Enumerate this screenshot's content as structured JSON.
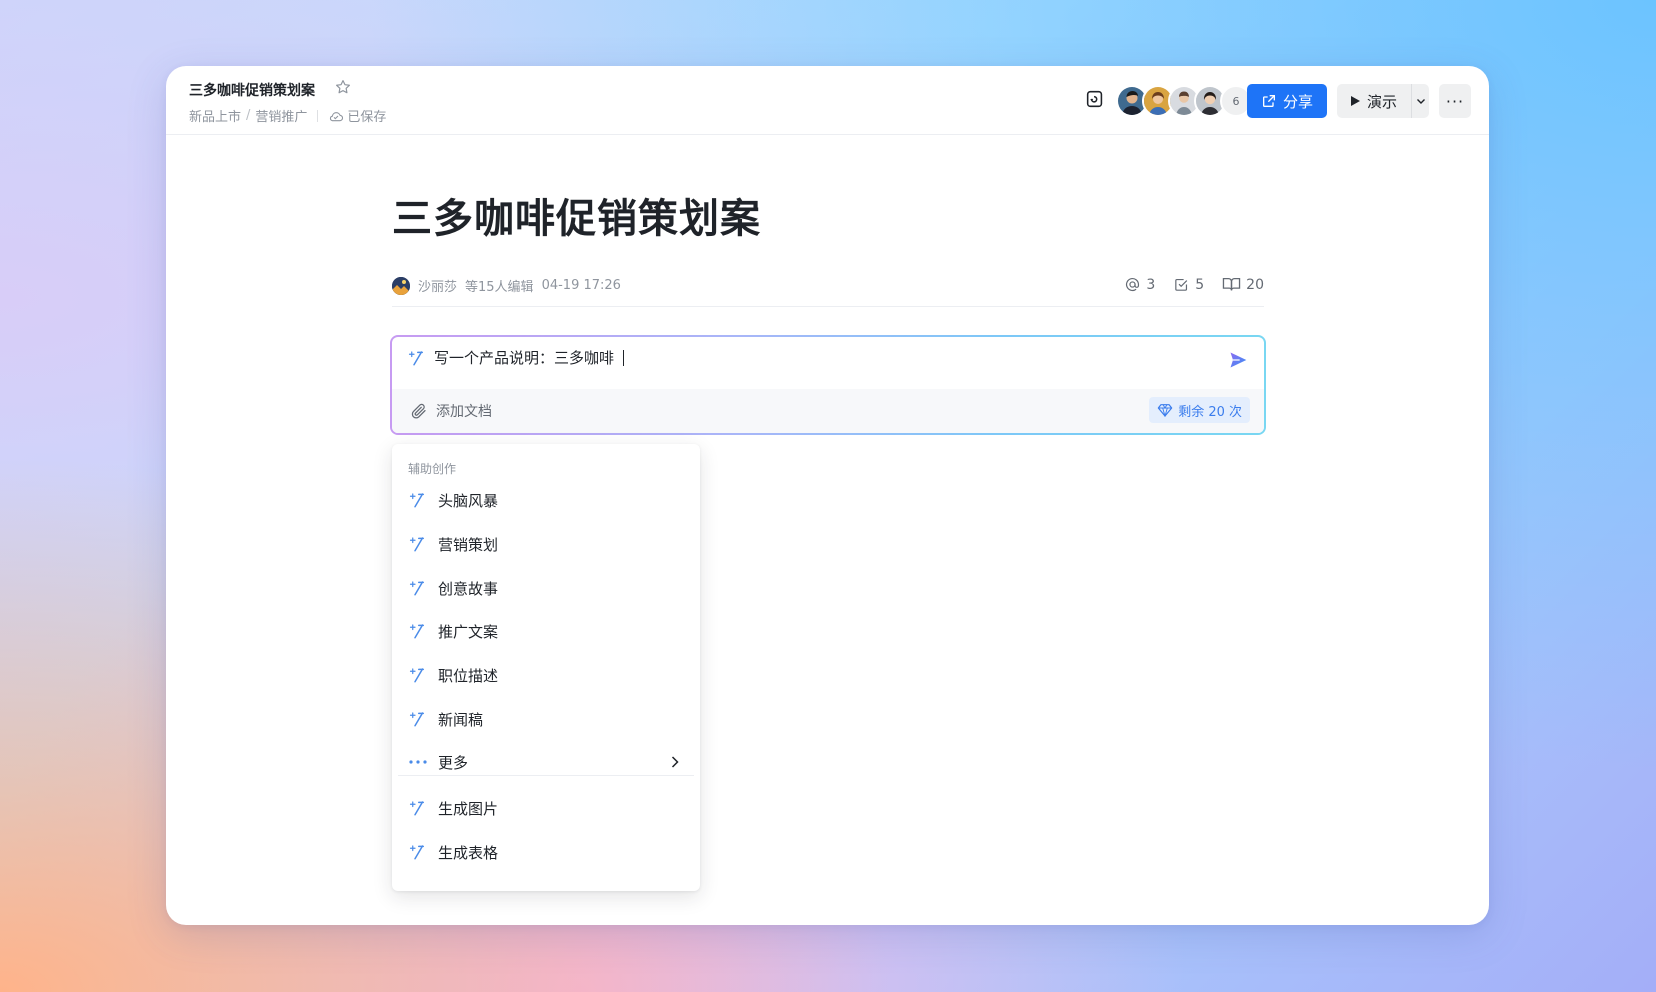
{
  "header": {
    "doc_title": "三多咖啡促销策划案",
    "breadcrumb": [
      "新品上市",
      "营销推广"
    ],
    "save_status": "已保存",
    "collaborator_count": "6",
    "share_label": "分享",
    "present_label": "演示",
    "more_label": "···"
  },
  "doc": {
    "title": "三多咖啡促销策划案",
    "author": "沙丽莎",
    "editors_text": "等15人编辑",
    "updated": "04-19 17:26",
    "stats": {
      "mentions": "3",
      "tasks": "5",
      "reads": "20"
    }
  },
  "ai_box": {
    "input_value": "写一个产品说明：三多咖啡",
    "attach_label": "添加文档",
    "quota_label": "剩余 20 次"
  },
  "menu": {
    "group_title": "辅助创作",
    "items": [
      {
        "label": "头脑风暴"
      },
      {
        "label": "营销策划"
      },
      {
        "label": "创意故事"
      },
      {
        "label": "推广文案"
      },
      {
        "label": "职位描述"
      },
      {
        "label": "新闻稿"
      },
      {
        "label": "更多"
      }
    ],
    "extra_items": [
      {
        "label": "生成图片"
      },
      {
        "label": "生成表格"
      }
    ]
  },
  "colors": {
    "primary": "#1e74f7",
    "accent_gradient_start": "#c79bf2",
    "accent_gradient_end": "#79d7f2",
    "text": "#1f2329",
    "muted": "#8f959e"
  }
}
